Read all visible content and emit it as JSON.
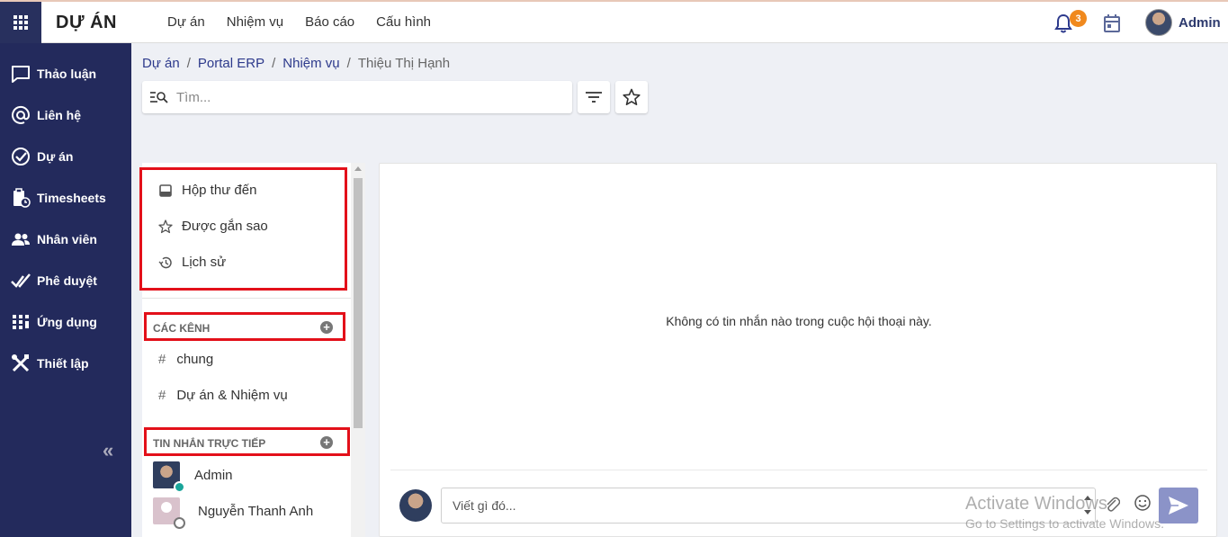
{
  "app": {
    "title": "DỰ ÁN"
  },
  "topnav": [
    "Dự án",
    "Nhiệm vụ",
    "Báo cáo",
    "Cấu hình"
  ],
  "notifications": {
    "count": "3"
  },
  "user": {
    "name": "Admin"
  },
  "sidebar": {
    "items": [
      {
        "label": "Thảo luận",
        "icon": "chat-icon"
      },
      {
        "label": "Liên hệ",
        "icon": "at-icon"
      },
      {
        "label": "Dự án",
        "icon": "check-circle-icon"
      },
      {
        "label": "Timesheets",
        "icon": "clipboard-clock-icon"
      },
      {
        "label": "Nhân viên",
        "icon": "users-icon"
      },
      {
        "label": "Phê duyệt",
        "icon": "double-check-icon"
      },
      {
        "label": "Ứng dụng",
        "icon": "apps-icon"
      },
      {
        "label": "Thiết lập",
        "icon": "tools-icon"
      }
    ],
    "collapse_label": "«"
  },
  "breadcrumb": {
    "items": [
      "Dự án",
      "Portal ERP",
      "Nhiệm vụ",
      "Thiệu Thị Hạnh"
    ],
    "separator": "/"
  },
  "search": {
    "placeholder": "Tìm..."
  },
  "mailboxes": [
    {
      "label": "Hộp thư đến",
      "icon": "inbox-icon"
    },
    {
      "label": "Được gắn sao",
      "icon": "star-icon"
    },
    {
      "label": "Lịch sử",
      "icon": "history-icon"
    }
  ],
  "channels": {
    "header": "CÁC KÊNH",
    "items": [
      "chung",
      "Dự án & Nhiệm vụ"
    ]
  },
  "direct_messages": {
    "header": "TIN NHẮN TRỰC TIẾP",
    "items": [
      {
        "name": "Admin",
        "status": "online"
      },
      {
        "name": "Nguyễn Thanh Anh",
        "status": "offline"
      }
    ]
  },
  "chat": {
    "empty_message": "Không có tin nhắn nào trong cuộc hội thoại này.",
    "composer_placeholder": "Viết gì đó..."
  },
  "watermark": {
    "line1": "Activate Windows",
    "line2": "Go to Settings to activate Windows."
  },
  "colors": {
    "sidebar_bg": "#232a5c",
    "highlight_box": "#e3101a",
    "badge": "#f0891e",
    "send_button": "#8b93c8",
    "online": "#1aa59a"
  }
}
